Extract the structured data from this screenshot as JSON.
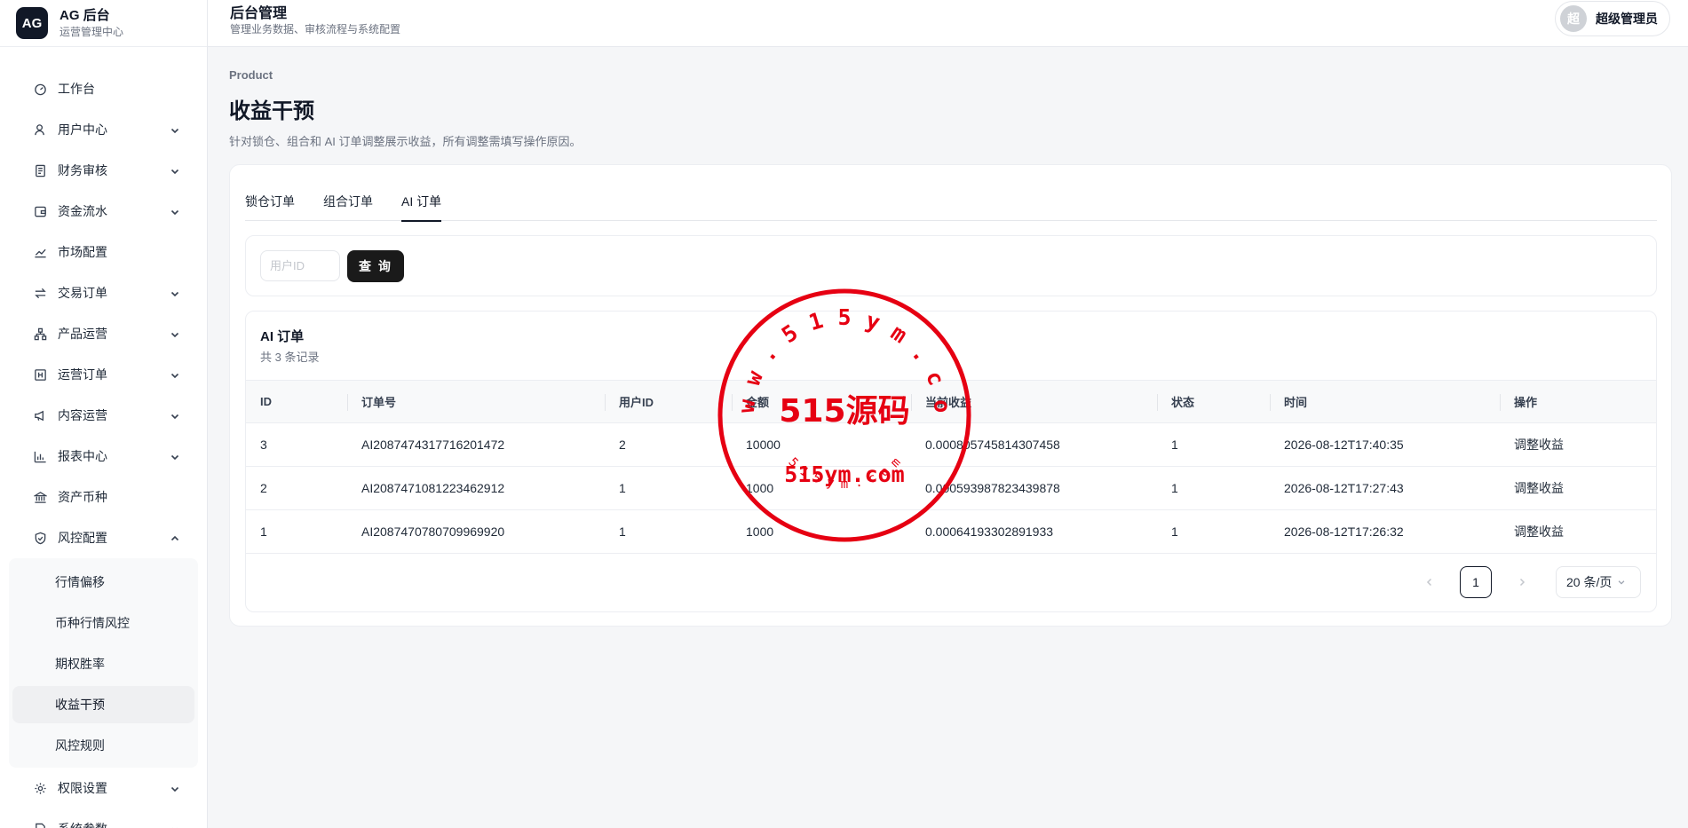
{
  "brand": {
    "logo": "AG",
    "name": "AG 后台",
    "subtitle": "运营管理中心"
  },
  "header": {
    "title": "后台管理",
    "subtitle": "管理业务数据、审核流程与系统配置"
  },
  "user": {
    "avatar": "超",
    "name": "超级管理员"
  },
  "sidebar": {
    "items": [
      {
        "label": "工作台",
        "icon": "dashboard-icon"
      },
      {
        "label": "用户中心",
        "icon": "user-icon",
        "expandable": true
      },
      {
        "label": "财务审核",
        "icon": "receipt-icon",
        "expandable": true
      },
      {
        "label": "资金流水",
        "icon": "wallet-icon",
        "expandable": true
      },
      {
        "label": "市场配置",
        "icon": "trend-icon"
      },
      {
        "label": "交易订单",
        "icon": "exchange-icon",
        "expandable": true
      },
      {
        "label": "产品运营",
        "icon": "network-icon",
        "expandable": true
      },
      {
        "label": "运营订单",
        "icon": "ledger-icon",
        "expandable": true
      },
      {
        "label": "内容运营",
        "icon": "megaphone-icon",
        "expandable": true
      },
      {
        "label": "报表中心",
        "icon": "bar-chart-icon",
        "expandable": true
      },
      {
        "label": "资产币种",
        "icon": "bank-icon"
      },
      {
        "label": "风控配置",
        "icon": "shield-icon",
        "expanded": true
      },
      {
        "label": "权限设置",
        "icon": "gear-icon",
        "expandable": true
      },
      {
        "label": "系统参数",
        "icon": "document-icon",
        "expandable": true
      }
    ],
    "risk_subitems": [
      "行情偏移",
      "币种行情风控",
      "期权胜率",
      "收益干预",
      "风控规则"
    ],
    "active_subitem": "收益干预"
  },
  "page": {
    "breadcrumb": "Product",
    "title": "收益干预",
    "description": "针对锁仓、组合和 AI 订单调整展示收益，所有调整需填写操作原因。"
  },
  "tabs": [
    "锁仓订单",
    "组合订单",
    "AI 订单"
  ],
  "active_tab": "AI 订单",
  "filter": {
    "user_id_placeholder": "用户ID",
    "user_id_value": "",
    "query_label": "查 询"
  },
  "table": {
    "title": "AI 订单",
    "count": "共 3 条记录",
    "columns": [
      "ID",
      "订单号",
      "用户ID",
      "金额",
      "当前收益",
      "状态",
      "时间",
      "操作"
    ],
    "rows": [
      [
        "3",
        "AI2087474317716201472",
        "2",
        "10000",
        "0.000805745814307458",
        "1",
        "2026-08-12T17:40:35",
        "调整收益"
      ],
      [
        "2",
        "AI2087471081223462912",
        "1",
        "1000",
        "0.000593987823439878",
        "1",
        "2026-08-12T17:27:43",
        "调整收益"
      ],
      [
        "1",
        "AI2087470780709969920",
        "1",
        "1000",
        "0.00064193302891933",
        "1",
        "2026-08-12T17:26:32",
        "调整收益"
      ]
    ]
  },
  "pagination": {
    "current_page": "1",
    "page_size": "20 条/页"
  },
  "watermark": {
    "top_arc": "w w w . 5 1 5 y m . c o m",
    "center": "515源码",
    "domain": "515ym.com",
    "bottom_arc": "5 1 5 y m . c o m",
    "color": "#e60012"
  }
}
